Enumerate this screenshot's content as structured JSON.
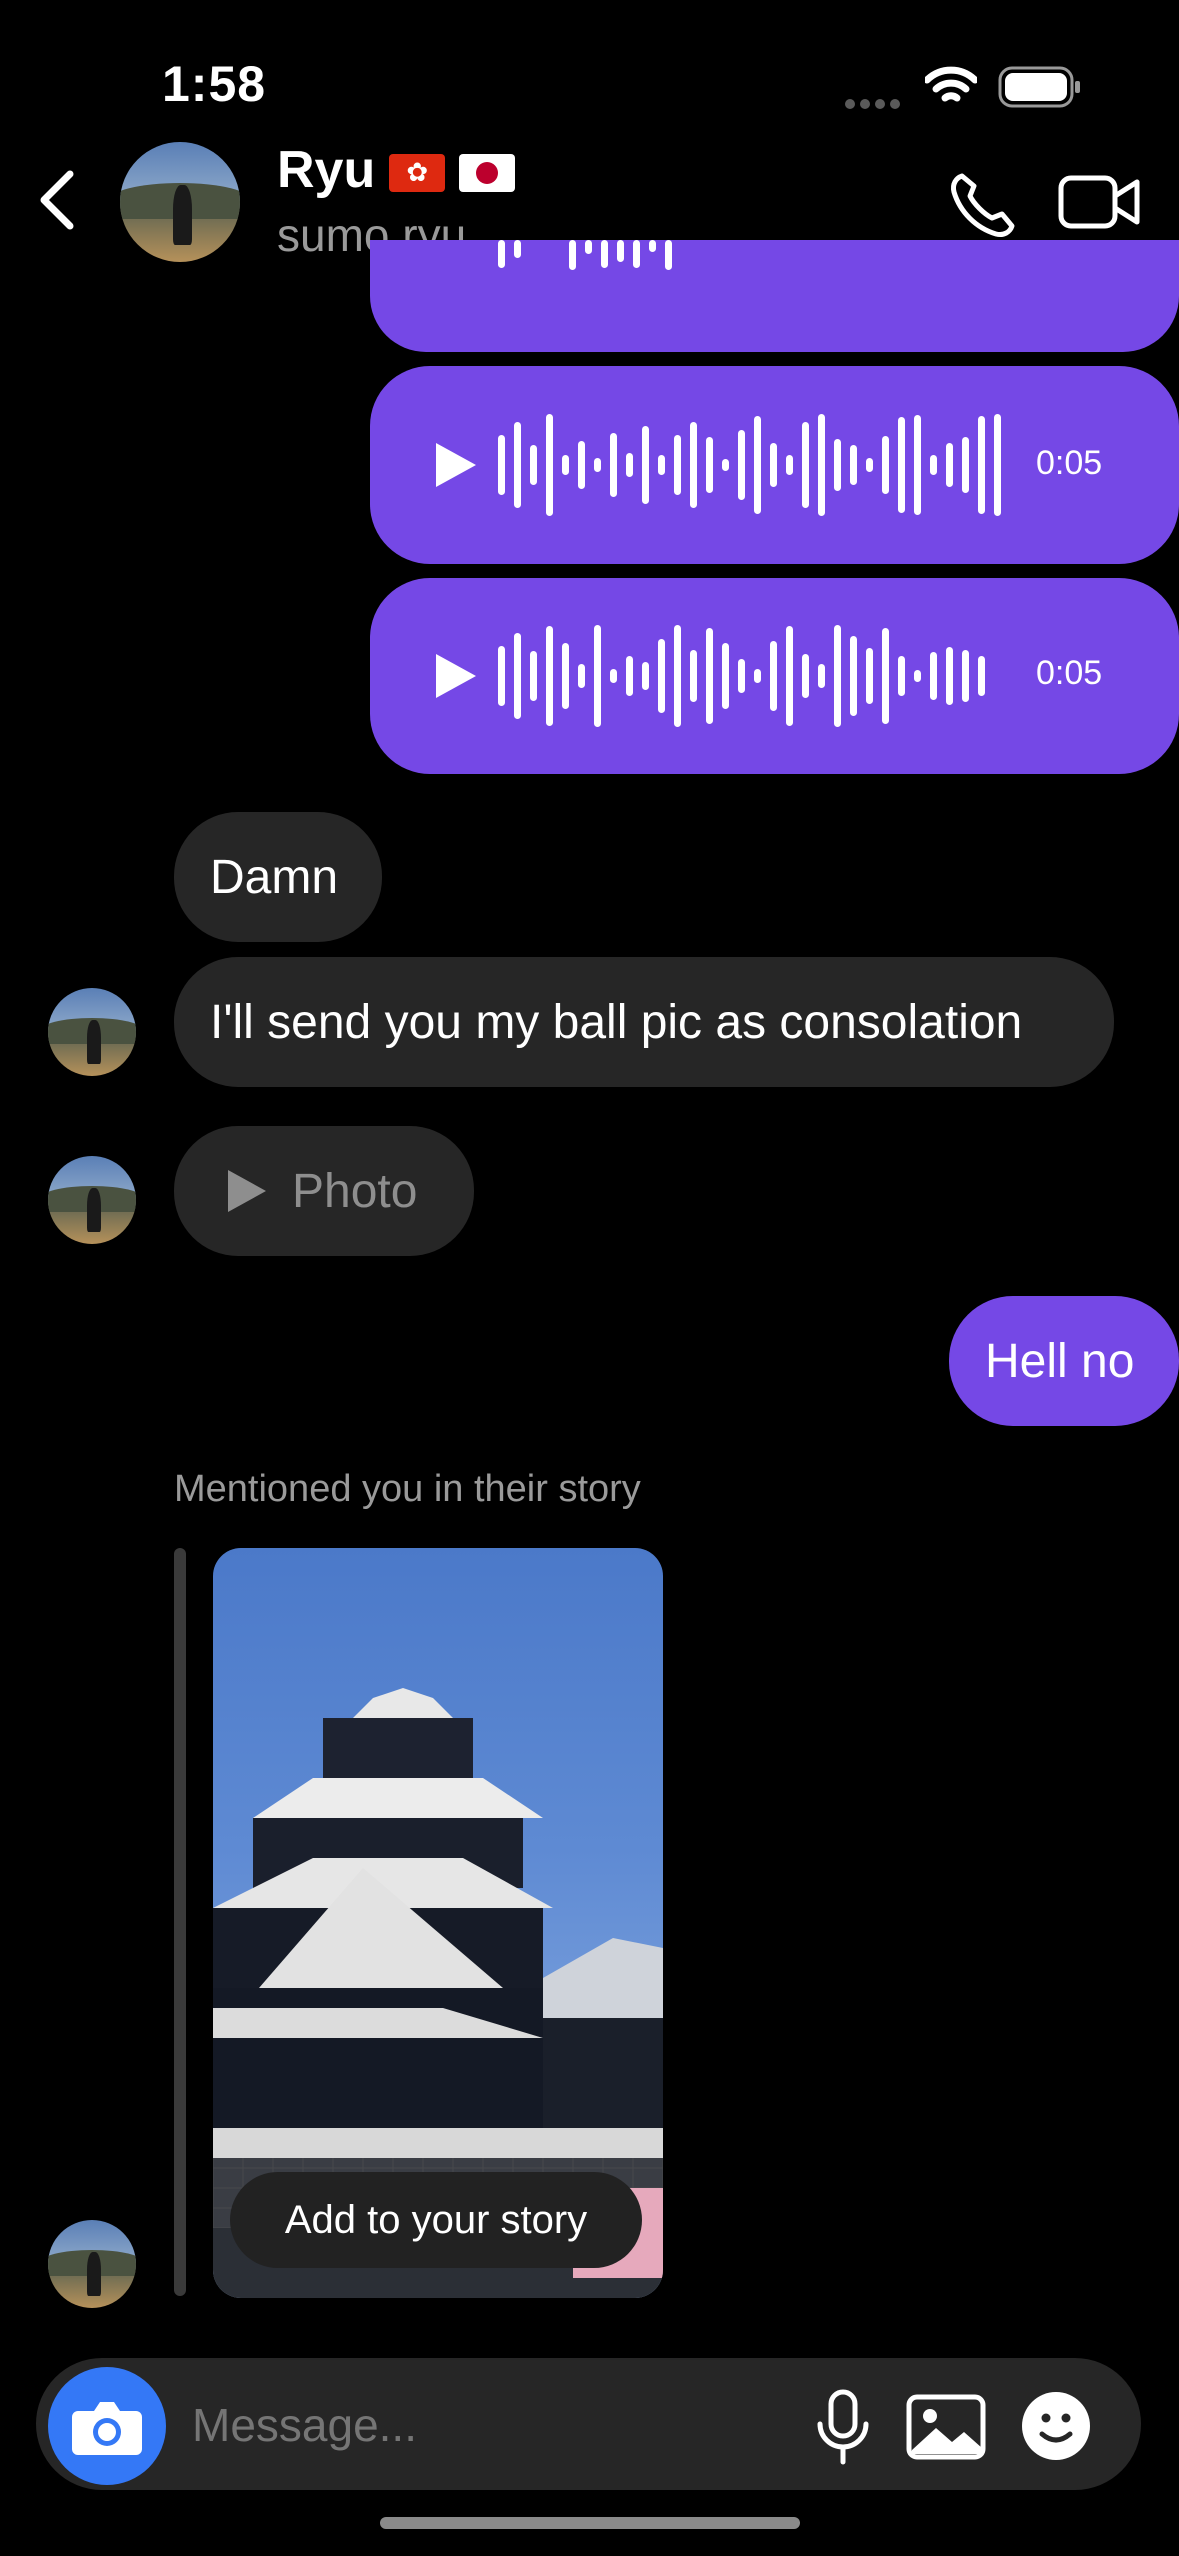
{
  "status_bar": {
    "time": "1:58"
  },
  "header": {
    "name": "Ryu",
    "username": "sumo.ryu",
    "flags": [
      "flag-hk",
      "flag-jp"
    ]
  },
  "messages": {
    "voice_1": {
      "duration": "0:05"
    },
    "voice_2": {
      "duration": "0:05"
    },
    "in_1": "Damn",
    "in_2": "I'll send you my ball pic as consolation",
    "in_photo": "Photo",
    "out_1": "Hell no",
    "story_caption": "Mentioned you in their story",
    "story_action": "Add to your story"
  },
  "composer": {
    "placeholder": "Message..."
  },
  "colors": {
    "outgoing": "#7548e6",
    "incoming": "#262626",
    "camera": "#3478f6"
  }
}
